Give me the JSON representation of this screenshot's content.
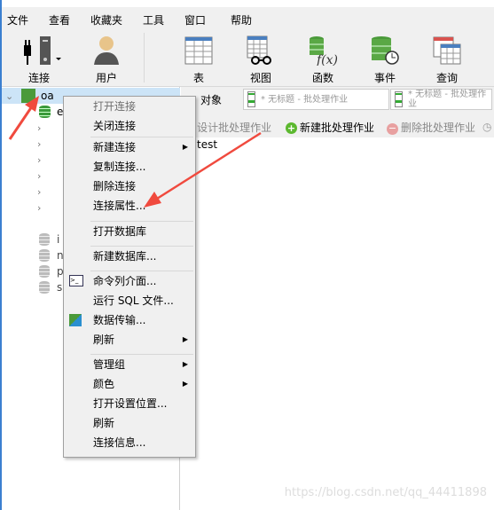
{
  "menubar": [
    "文件",
    "查看",
    "收藏夹",
    "工具",
    "窗口",
    "帮助"
  ],
  "toolbar": {
    "connect": "连接",
    "user": "用户",
    "table": "表",
    "view": "视图",
    "function": "函数",
    "event": "事件",
    "query": "查询"
  },
  "tree": {
    "connection": "oa",
    "items": [
      "e",
      "i",
      "n",
      "p",
      "s"
    ]
  },
  "tabs": {
    "objects": "对象",
    "doc1": "* 无标题 - 批处理作业",
    "doc2": "* 无标题 - 批处理作业"
  },
  "subtoolbar": {
    "design": "设计批处理作业",
    "new": "新建批处理作业",
    "delete": "删除批处理作业"
  },
  "content": {
    "item": "test"
  },
  "context_menu": [
    {
      "label": "打开连接",
      "disabled": true
    },
    {
      "label": "关闭连接"
    },
    {
      "label": "新建连接",
      "submenu": true
    },
    {
      "label": "复制连接..."
    },
    {
      "label": "删除连接"
    },
    {
      "label": "连接属性..."
    },
    {
      "label": "打开数据库"
    },
    {
      "label": "新建数据库..."
    },
    {
      "label": "命令列介面..."
    },
    {
      "label": "运行 SQL 文件..."
    },
    {
      "label": "数据传输..."
    },
    {
      "label": "刷新",
      "submenu": true
    },
    {
      "label": "管理组",
      "submenu": true
    },
    {
      "label": "颜色",
      "submenu": true
    },
    {
      "label": "打开设置位置..."
    },
    {
      "label": "刷新"
    },
    {
      "label": "连接信息..."
    }
  ],
  "watermark": "https://blog.csdn.net/qq_44411898",
  "colors": {
    "selection": "#cce4f7",
    "arrow": "#f04a3e",
    "accent": "#3b7fd0"
  }
}
